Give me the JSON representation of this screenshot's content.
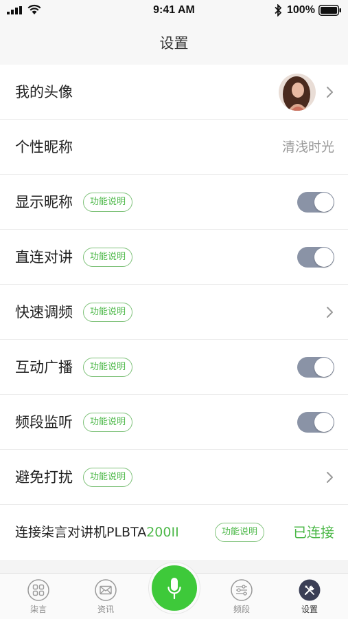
{
  "status_bar": {
    "time": "9:41 AM",
    "battery": "100%"
  },
  "nav": {
    "title": "设置"
  },
  "rows": [
    {
      "label": "我的头像",
      "control": "avatar-chevron"
    },
    {
      "label": "个性昵称",
      "value": "清浅时光"
    },
    {
      "label": "显示昵称",
      "tag": "功能说明",
      "toggle": true
    },
    {
      "label": "直连对讲",
      "tag": "功能说明",
      "toggle": true
    },
    {
      "label": "快速调频",
      "tag": "功能说明",
      "control": "chevron"
    },
    {
      "label": "互动广播",
      "tag": "功能说明",
      "toggle": true
    },
    {
      "label": "频段监听",
      "tag": "功能说明",
      "toggle": true
    },
    {
      "label": "避免打扰",
      "tag": "功能说明",
      "control": "chevron"
    },
    {
      "label_prefix": "连接柒言对讲机PLBTA",
      "label_suffix": "200II",
      "tag": "功能说明",
      "value": "已连接"
    }
  ],
  "tabs": [
    {
      "label": "柒言",
      "icon": "grid-icon"
    },
    {
      "label": "资讯",
      "icon": "envelope-icon"
    },
    {
      "label": "频段",
      "icon": "sliders-icon"
    },
    {
      "label": "设置",
      "icon": "tools-icon",
      "active": true
    }
  ],
  "colors": {
    "accent_green": "#4cb848",
    "toggle_on": "#8a93a6",
    "mic_button": "#3ec93a"
  }
}
